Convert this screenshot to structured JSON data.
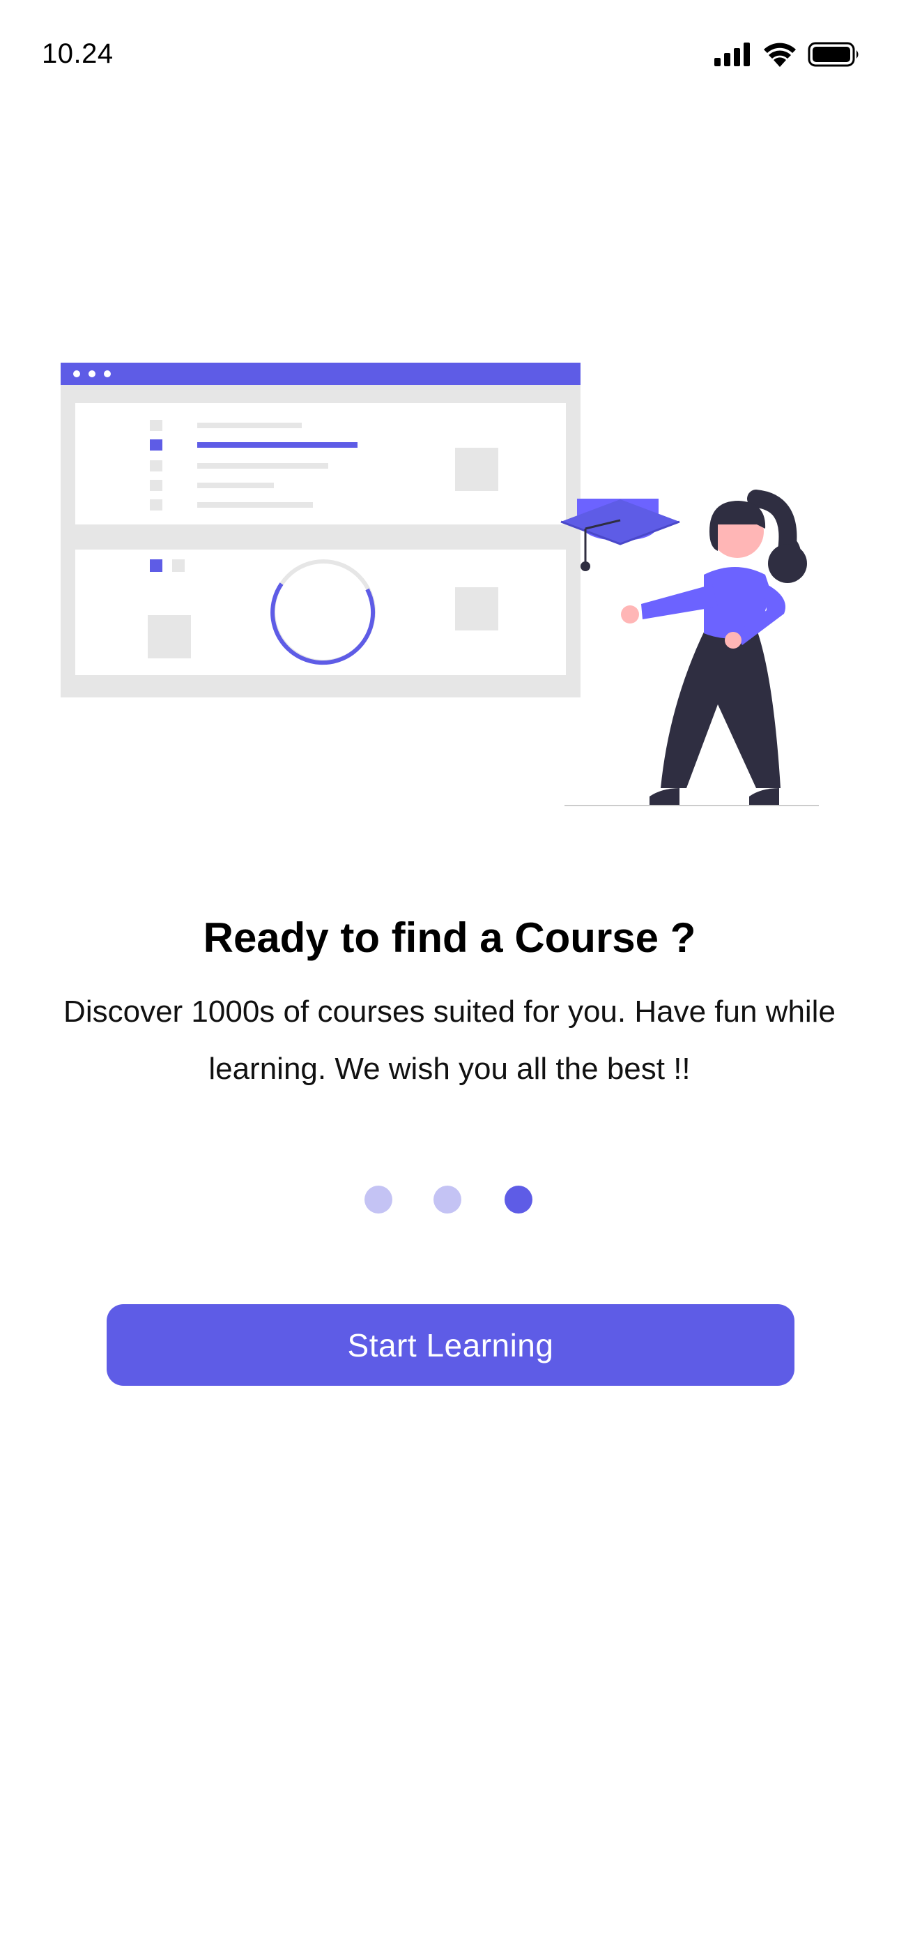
{
  "status_bar": {
    "time": "10.24",
    "icons": [
      "cellular-signal-icon",
      "wifi-icon",
      "battery-icon"
    ]
  },
  "illustration": {
    "name": "online-course-illustration",
    "icons": [
      "browser-window-icon",
      "graduation-cap-icon",
      "person-icon"
    ]
  },
  "onboarding": {
    "title": "Ready to find a Course ?",
    "description": "Discover 1000s of courses suited for you. Have fun while learning. We wish you all the best !!",
    "page_indicator": {
      "total": 3,
      "current": 3
    },
    "cta_label": "Start Learning"
  },
  "colors": {
    "accent": "#5e5ce6",
    "accent_light": "#c4c3f4",
    "panel_gray": "#e6e6e6",
    "shirt": "#6c63ff",
    "dark": "#2f2e41",
    "skin": "#ffb6b6"
  }
}
